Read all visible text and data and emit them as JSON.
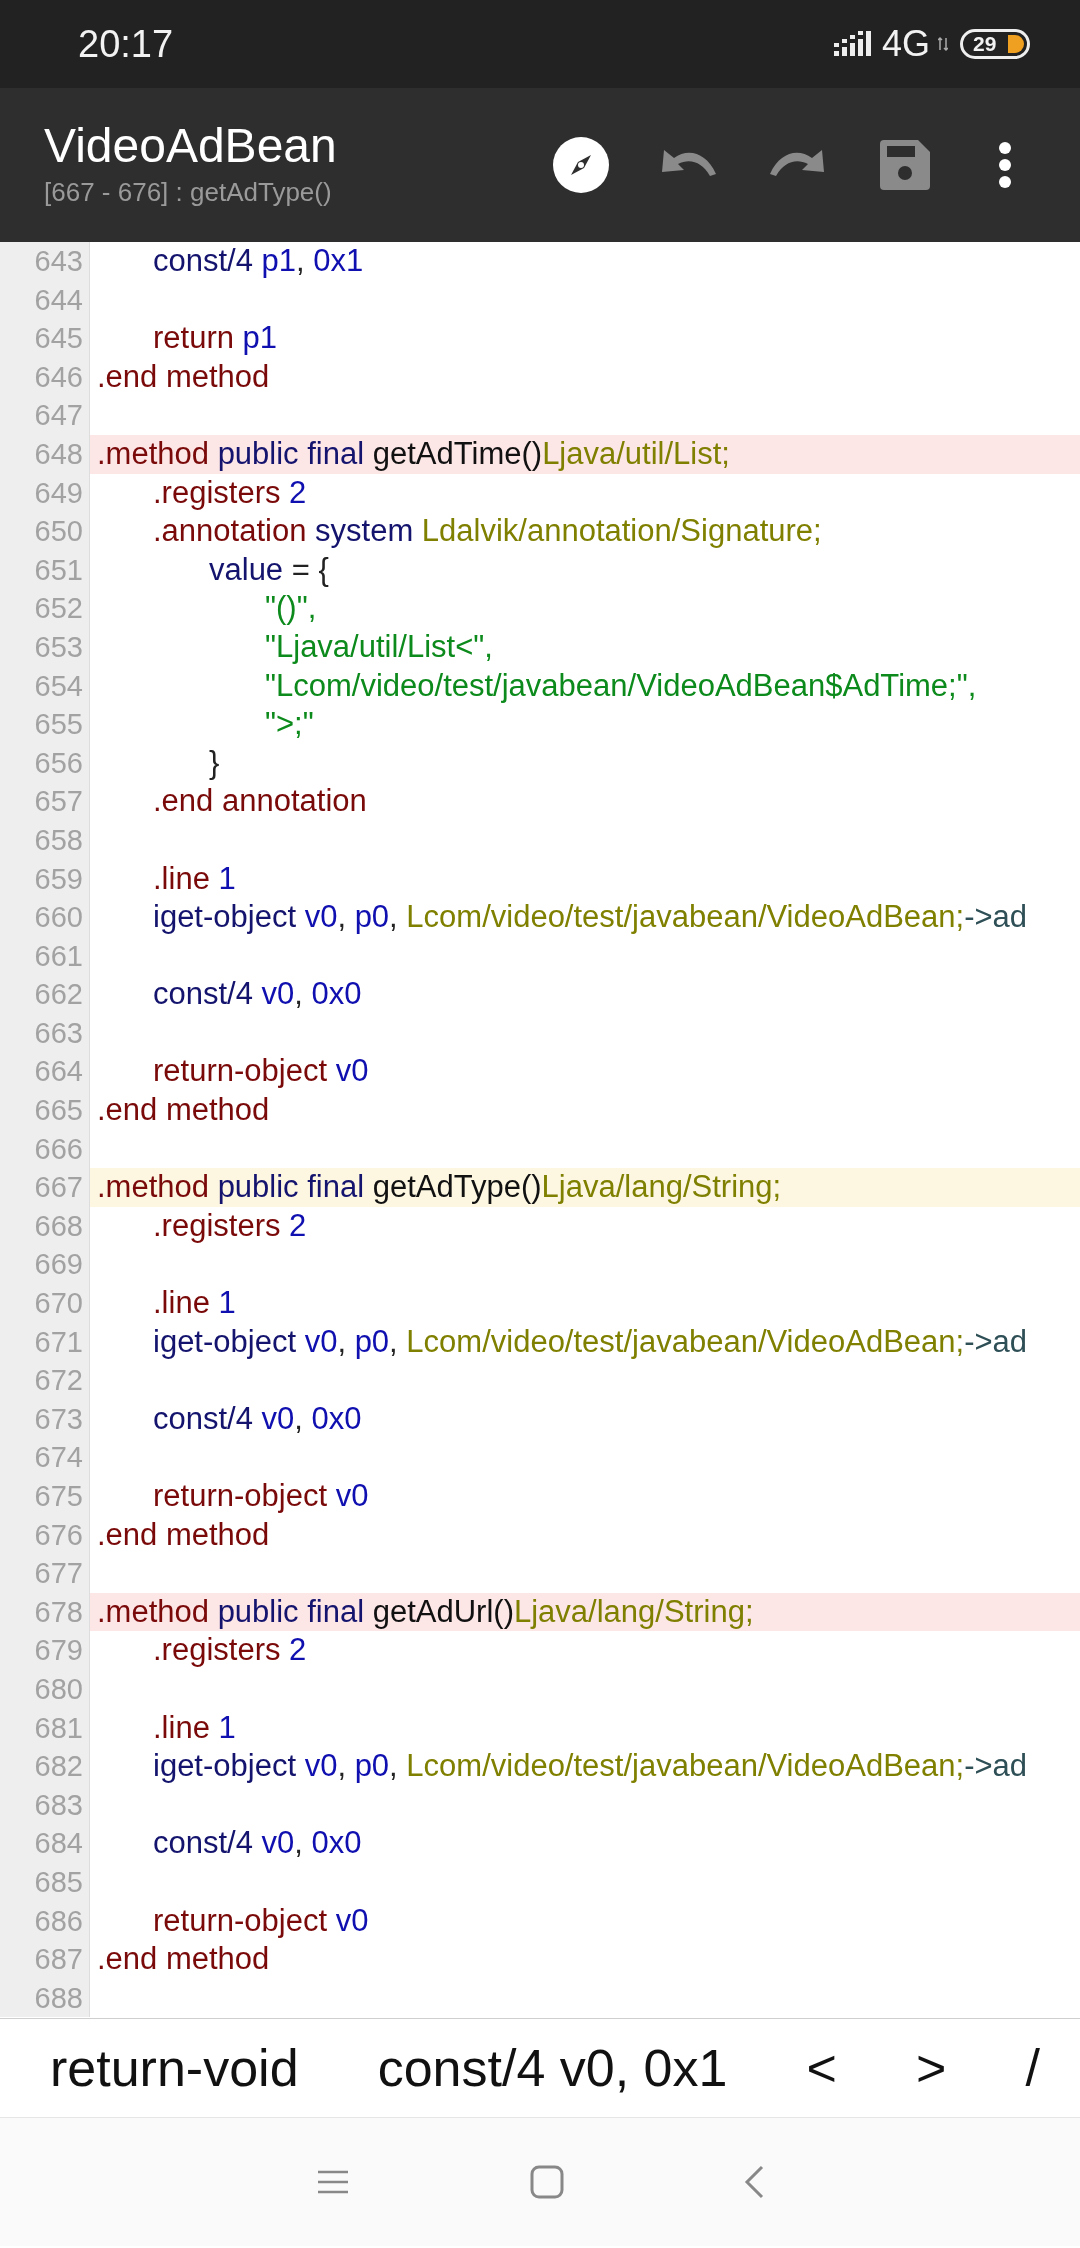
{
  "status_bar": {
    "time": "20:17",
    "network": "4G",
    "battery": "29"
  },
  "toolbar": {
    "title": "VideoAdBean",
    "subtitle": "[667 - 676] : getAdType()"
  },
  "editor": {
    "lines": [
      {
        "number": "643",
        "kind": "code",
        "selected": false,
        "tokens": [
          {
            "kind": "kw",
            "text": "\tconst/4 "
          },
          {
            "kind": "reg",
            "text": "p1"
          },
          {
            "kind": "plain",
            "text": ", "
          },
          {
            "kind": "reg",
            "text": "0x1"
          }
        ]
      },
      {
        "number": "644",
        "kind": "code",
        "selected": false
      },
      {
        "number": "645",
        "kind": "code",
        "selected": false,
        "tokens": [
          {
            "kind": "dir",
            "text": "\treturn "
          },
          {
            "kind": "reg",
            "text": "p1"
          }
        ]
      },
      {
        "number": "646",
        "kind": "code",
        "selected": false,
        "tokens": [
          {
            "kind": "dir",
            "text": ".end method"
          }
        ]
      },
      {
        "number": "647",
        "kind": "code",
        "selected": false
      },
      {
        "number": "648",
        "kind": "method",
        "selected": false,
        "tokens": [
          {
            "kind": "dir",
            "text": ".method "
          },
          {
            "kind": "kw",
            "text": "public final "
          },
          {
            "kind": "name",
            "text": "getAdTime()"
          },
          {
            "kind": "type",
            "text": "Ljava/util/List;"
          }
        ]
      },
      {
        "number": "649",
        "kind": "code",
        "selected": false,
        "tokens": [
          {
            "kind": "dir",
            "text": "\t.registers "
          },
          {
            "kind": "reg",
            "text": "2"
          }
        ]
      },
      {
        "number": "650",
        "kind": "code",
        "selected": false,
        "tokens": [
          {
            "kind": "dir",
            "text": "\t.annotation "
          },
          {
            "kind": "kw",
            "text": "system "
          },
          {
            "kind": "type",
            "text": "Ldalvik/annotation/Signature;"
          }
        ]
      },
      {
        "number": "651",
        "kind": "code",
        "selected": false,
        "tokens": [
          {
            "kind": "kw",
            "text": "\t\tvalue "
          },
          {
            "kind": "plain",
            "text": "= {"
          }
        ]
      },
      {
        "number": "652",
        "kind": "code",
        "selected": false,
        "tokens": [
          {
            "kind": "str",
            "text": "\t\t\t\"()\","
          }
        ]
      },
      {
        "number": "653",
        "kind": "code",
        "selected": false,
        "tokens": [
          {
            "kind": "str",
            "text": "\t\t\t\"Ljava/util/List<\","
          }
        ]
      },
      {
        "number": "654",
        "kind": "code",
        "selected": false,
        "tokens": [
          {
            "kind": "str",
            "text": "\t\t\t\"Lcom/video/test/javabean/VideoAdBean$AdTime;\","
          }
        ]
      },
      {
        "number": "655",
        "kind": "code",
        "selected": false,
        "tokens": [
          {
            "kind": "str",
            "text": "\t\t\t\">;\""
          }
        ]
      },
      {
        "number": "656",
        "kind": "code",
        "selected": false,
        "tokens": [
          {
            "kind": "plain",
            "text": "\t\t}"
          }
        ]
      },
      {
        "number": "657",
        "kind": "code",
        "selected": false,
        "tokens": [
          {
            "kind": "dir",
            "text": "\t.end annotation"
          }
        ]
      },
      {
        "number": "658",
        "kind": "code",
        "selected": false
      },
      {
        "number": "659",
        "kind": "code",
        "selected": false,
        "tokens": [
          {
            "kind": "dir",
            "text": "\t.line "
          },
          {
            "kind": "reg",
            "text": "1"
          }
        ]
      },
      {
        "number": "660",
        "kind": "code",
        "selected": false,
        "tokens": [
          {
            "kind": "kw",
            "text": "\tiget-object "
          },
          {
            "kind": "reg",
            "text": "v0"
          },
          {
            "kind": "plain",
            "text": ", "
          },
          {
            "kind": "reg",
            "text": "p0"
          },
          {
            "kind": "plain",
            "text": ", "
          },
          {
            "kind": "type",
            "text": "Lcom/video/test/javabean/VideoAdBean;"
          },
          {
            "kind": "ref",
            "text": "->ad"
          }
        ]
      },
      {
        "number": "661",
        "kind": "code",
        "selected": false
      },
      {
        "number": "662",
        "kind": "code",
        "selected": false,
        "tokens": [
          {
            "kind": "kw",
            "text": "\tconst/4 "
          },
          {
            "kind": "reg",
            "text": "v0"
          },
          {
            "kind": "plain",
            "text": ", "
          },
          {
            "kind": "reg",
            "text": "0x0"
          }
        ]
      },
      {
        "number": "663",
        "kind": "code",
        "selected": false
      },
      {
        "number": "664",
        "kind": "code",
        "selected": false,
        "tokens": [
          {
            "kind": "dir",
            "text": "\treturn-object "
          },
          {
            "kind": "reg",
            "text": "v0"
          }
        ]
      },
      {
        "number": "665",
        "kind": "code",
        "selected": false,
        "tokens": [
          {
            "kind": "dir",
            "text": ".end method"
          }
        ]
      },
      {
        "number": "666",
        "kind": "code",
        "selected": false
      },
      {
        "number": "667",
        "kind": "code",
        "selected": true,
        "tokens": [
          {
            "kind": "dir",
            "text": ".method "
          },
          {
            "kind": "kw",
            "text": "public final "
          },
          {
            "kind": "name",
            "text": "getAdType()"
          },
          {
            "kind": "type",
            "text": "Ljava/lang/String;"
          }
        ]
      },
      {
        "number": "668",
        "kind": "code",
        "selected": false,
        "tokens": [
          {
            "kind": "dir",
            "text": "\t.registers "
          },
          {
            "kind": "reg",
            "text": "2"
          }
        ]
      },
      {
        "number": "669",
        "kind": "code",
        "selected": false
      },
      {
        "number": "670",
        "kind": "code",
        "selected": false,
        "tokens": [
          {
            "kind": "dir",
            "text": "\t.line "
          },
          {
            "kind": "reg",
            "text": "1"
          }
        ]
      },
      {
        "number": "671",
        "kind": "code",
        "selected": false,
        "tokens": [
          {
            "kind": "kw",
            "text": "\tiget-object "
          },
          {
            "kind": "reg",
            "text": "v0"
          },
          {
            "kind": "plain",
            "text": ", "
          },
          {
            "kind": "reg",
            "text": "p0"
          },
          {
            "kind": "plain",
            "text": ", "
          },
          {
            "kind": "type",
            "text": "Lcom/video/test/javabean/VideoAdBean;"
          },
          {
            "kind": "ref",
            "text": "->ad"
          }
        ]
      },
      {
        "number": "672",
        "kind": "code",
        "selected": false
      },
      {
        "number": "673",
        "kind": "code",
        "selected": false,
        "tokens": [
          {
            "kind": "kw",
            "text": "\tconst/4 "
          },
          {
            "kind": "reg",
            "text": "v0"
          },
          {
            "kind": "plain",
            "text": ", "
          },
          {
            "kind": "reg",
            "text": "0x0"
          }
        ]
      },
      {
        "number": "674",
        "kind": "code",
        "selected": false
      },
      {
        "number": "675",
        "kind": "code",
        "selected": false,
        "tokens": [
          {
            "kind": "dir",
            "text": "\treturn-object "
          },
          {
            "kind": "reg",
            "text": "v0"
          }
        ]
      },
      {
        "number": "676",
        "kind": "code",
        "selected": false,
        "tokens": [
          {
            "kind": "dir",
            "text": ".end method"
          }
        ]
      },
      {
        "number": "677",
        "kind": "code",
        "selected": false
      },
      {
        "number": "678",
        "kind": "method",
        "selected": false,
        "tokens": [
          {
            "kind": "dir",
            "text": ".method "
          },
          {
            "kind": "kw",
            "text": "public final "
          },
          {
            "kind": "name",
            "text": "getAdUrl()"
          },
          {
            "kind": "type",
            "text": "Ljava/lang/String;"
          }
        ]
      },
      {
        "number": "679",
        "kind": "code",
        "selected": false,
        "tokens": [
          {
            "kind": "dir",
            "text": "\t.registers "
          },
          {
            "kind": "reg",
            "text": "2"
          }
        ]
      },
      {
        "number": "680",
        "kind": "code",
        "selected": false
      },
      {
        "number": "681",
        "kind": "code",
        "selected": false,
        "tokens": [
          {
            "kind": "dir",
            "text": "\t.line "
          },
          {
            "kind": "reg",
            "text": "1"
          }
        ]
      },
      {
        "number": "682",
        "kind": "code",
        "selected": false,
        "tokens": [
          {
            "kind": "kw",
            "text": "\tiget-object "
          },
          {
            "kind": "reg",
            "text": "v0"
          },
          {
            "kind": "plain",
            "text": ", "
          },
          {
            "kind": "reg",
            "text": "p0"
          },
          {
            "kind": "plain",
            "text": ", "
          },
          {
            "kind": "type",
            "text": "Lcom/video/test/javabean/VideoAdBean;"
          },
          {
            "kind": "ref",
            "text": "->ad"
          }
        ]
      },
      {
        "number": "683",
        "kind": "code",
        "selected": false
      },
      {
        "number": "684",
        "kind": "code",
        "selected": false,
        "tokens": [
          {
            "kind": "kw",
            "text": "\tconst/4 "
          },
          {
            "kind": "reg",
            "text": "v0"
          },
          {
            "kind": "plain",
            "text": ", "
          },
          {
            "kind": "reg",
            "text": "0x0"
          }
        ]
      },
      {
        "number": "685",
        "kind": "code",
        "selected": false
      },
      {
        "number": "686",
        "kind": "code",
        "selected": false,
        "tokens": [
          {
            "kind": "dir",
            "text": "\treturn-object "
          },
          {
            "kind": "reg",
            "text": "v0"
          }
        ]
      },
      {
        "number": "687",
        "kind": "code",
        "selected": false,
        "tokens": [
          {
            "kind": "dir",
            "text": ".end method"
          }
        ]
      },
      {
        "number": "688",
        "kind": "code",
        "selected": false
      }
    ]
  },
  "symbol_bar": [
    "return-void",
    "const/4 v0, 0x1",
    "<",
    ">",
    "/"
  ]
}
